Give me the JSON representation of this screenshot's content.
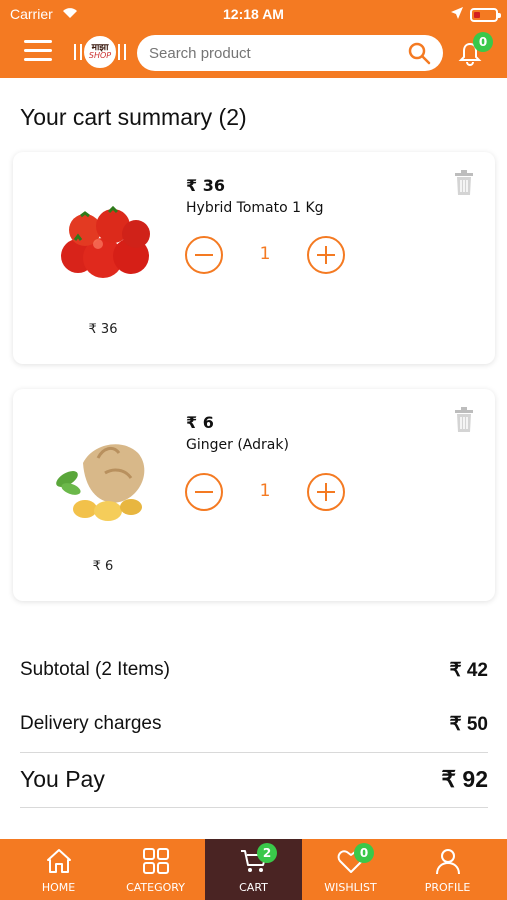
{
  "status_bar": {
    "carrier": "Carrier",
    "time": "12:18 AM"
  },
  "header": {
    "logo_line1": "माझा",
    "logo_line2": "SHOP",
    "search_placeholder": "Search product",
    "notification_count": "0"
  },
  "page_title": "Your cart summary (2)",
  "cart_items": [
    {
      "price": "₹ 36",
      "name": "Hybrid Tomato 1 Kg",
      "quantity": "1",
      "thumb_price": "₹ 36"
    },
    {
      "price": "₹ 6",
      "name": "Ginger (Adrak)",
      "quantity": "1",
      "thumb_price": "₹ 6"
    }
  ],
  "summary": {
    "subtotal_label": "Subtotal (2 Items)",
    "subtotal_value": "₹ 42",
    "delivery_label": "Delivery charges",
    "delivery_value": "₹ 50",
    "pay_label": "You Pay",
    "pay_value": "₹ 92"
  },
  "bottom_nav": {
    "items": [
      {
        "label": "HOME",
        "icon": "home-icon"
      },
      {
        "label": "CATEGORY",
        "icon": "grid-icon"
      },
      {
        "label": "CART",
        "icon": "cart-icon",
        "badge": "2",
        "active": true
      },
      {
        "label": "WISHLIST",
        "icon": "heart-icon",
        "badge": "0"
      },
      {
        "label": "PROFILE",
        "icon": "user-icon"
      }
    ]
  },
  "colors": {
    "accent": "#f47a22",
    "active_nav": "#4a2423",
    "badge": "#3ac84a"
  }
}
